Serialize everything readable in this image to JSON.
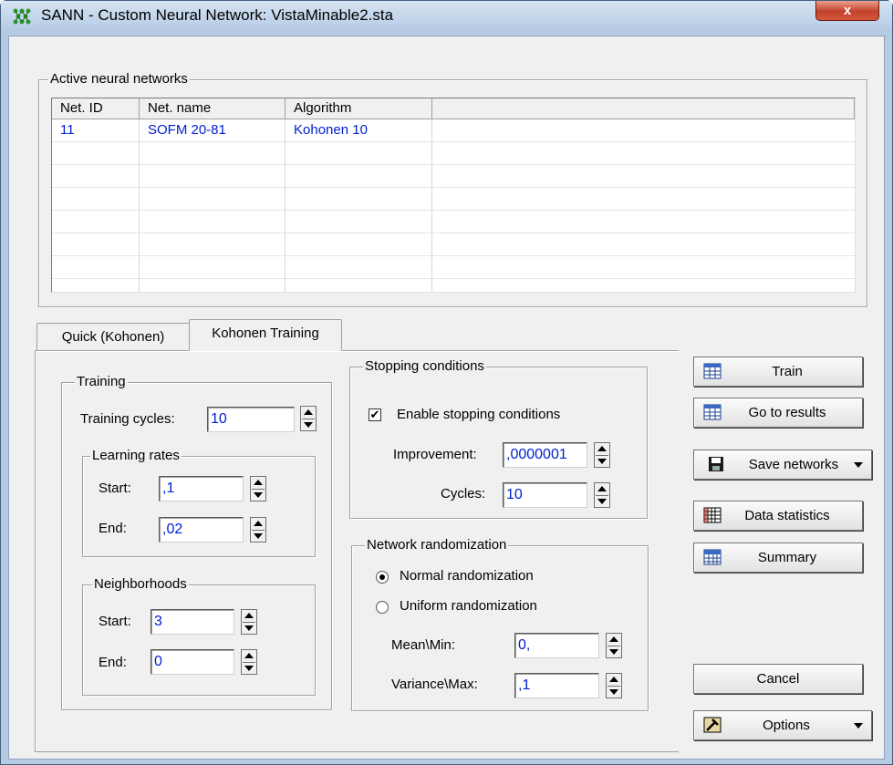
{
  "window": {
    "title": "SANN - Custom Neural Network: VistaMinable2.sta",
    "close_label": "x"
  },
  "networks": {
    "legend": "Active neural networks",
    "columns": [
      "Net. ID",
      "Net. name",
      "Algorithm"
    ],
    "rows": [
      {
        "id": "11",
        "name": "SOFM 20-81",
        "algorithm": "Kohonen 10"
      }
    ]
  },
  "tabs": [
    {
      "label": "Quick (Kohonen)"
    },
    {
      "label": "Kohonen Training"
    }
  ],
  "training": {
    "legend": "Training",
    "cycles_label": "Training cycles:",
    "cycles_value": "10",
    "learning_rates": {
      "legend": "Learning rates",
      "start_label": "Start:",
      "start_value": ",1",
      "end_label": "End:",
      "end_value": ",02"
    },
    "neighborhoods": {
      "legend": "Neighborhoods",
      "start_label": "Start:",
      "start_value": "3",
      "end_label": "End:",
      "end_value": "0"
    }
  },
  "stopping": {
    "legend": "Stopping conditions",
    "enable_label": "Enable stopping conditions",
    "enable_checked": true,
    "improvement_label": "Improvement:",
    "improvement_value": ",0000001",
    "cycles_label": "Cycles:",
    "cycles_value": "10"
  },
  "randomization": {
    "legend": "Network randomization",
    "normal_label": "Normal randomization",
    "uniform_label": "Uniform randomization",
    "selected": "normal",
    "mean_label": "Mean\\Min:",
    "mean_value": "0,",
    "variance_label": "Variance\\Max:",
    "variance_value": ",1"
  },
  "buttons": {
    "train": "Train",
    "go_to_results": "Go to results",
    "save_networks": "Save networks",
    "data_statistics": "Data statistics",
    "summary": "Summary",
    "cancel": "Cancel",
    "options": "Options"
  },
  "colors": {
    "value_text": "#0020d0",
    "client_bg": "#f0f0f0",
    "title_bg": "#c5d8ed"
  }
}
